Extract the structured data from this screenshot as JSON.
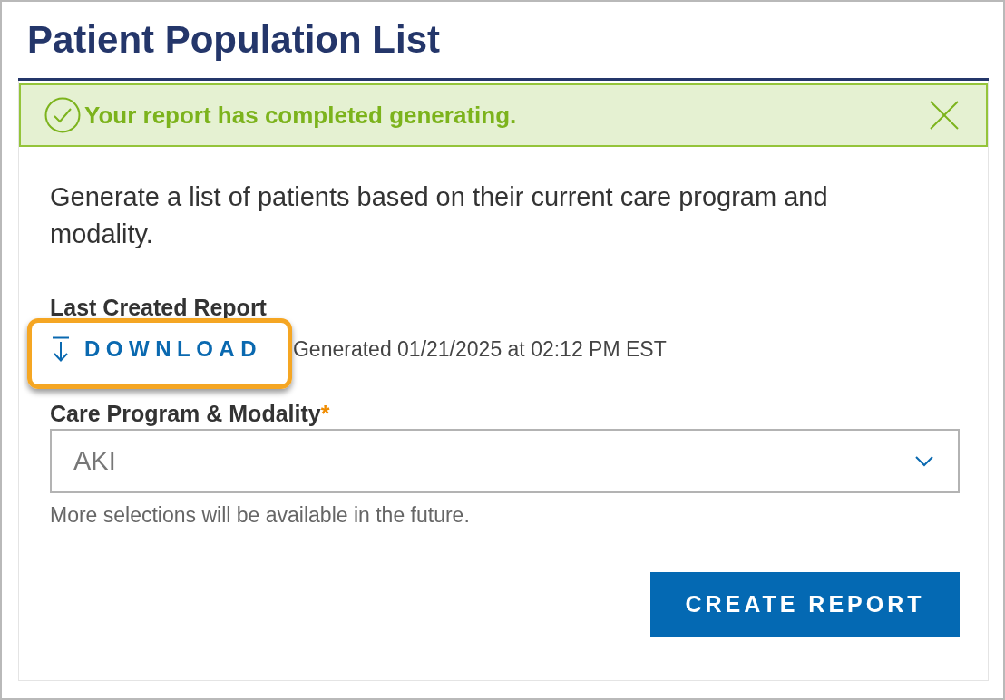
{
  "page": {
    "title": "Patient Population List"
  },
  "alert": {
    "kind": "success",
    "message": "Your report has completed generating.",
    "dismissible": true
  },
  "description": "Generate a list of patients based on their current care program and modality.",
  "last_report": {
    "label": "Last Created Report",
    "download": {
      "label": "DOWNLOAD",
      "highlighted": true
    },
    "generated": "Generated 01/21/2025 at 02:12 PM EST"
  },
  "care_program": {
    "label": "Care Program & Modality",
    "required_mark": "*",
    "value": "AKI",
    "help": "More selections will be available in the future."
  },
  "buttons": [
    {
      "label": "CREATE REPORT",
      "kind": "primary"
    }
  ]
}
